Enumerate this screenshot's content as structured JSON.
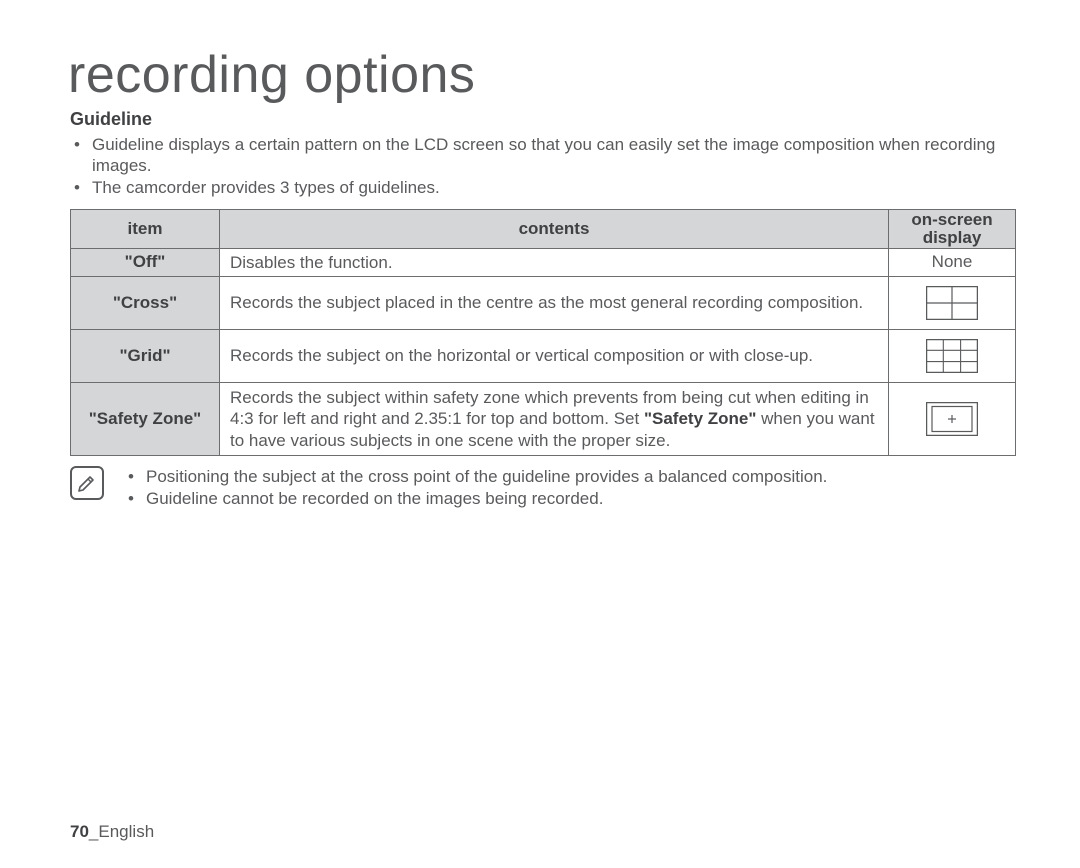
{
  "page": {
    "title": "recording options",
    "section_heading": "Guideline",
    "descriptions": [
      "Guideline displays a certain pattern on the LCD screen so that you can easily set the image composition when recording images.",
      "The camcorder provides 3 types of guidelines."
    ],
    "table": {
      "headers": {
        "item": "item",
        "contents": "contents",
        "osd": "on-screen display"
      },
      "rows": [
        {
          "item": "\"Off\"",
          "contents": "Disables the function.",
          "display": "None"
        },
        {
          "item": "\"Cross\"",
          "contents": "Records the subject placed in the centre as the most general recording composition.",
          "display": ""
        },
        {
          "item": "\"Grid\"",
          "contents": "Records the subject on the horizontal or vertical composition or with close-up.",
          "display": ""
        },
        {
          "item": "\"Safety Zone\"",
          "contents_pre": "Records the subject within safety zone which prevents from being cut when editing in 4:3 for left and right and 2.35:1 for top and bottom. Set ",
          "contents_bold": "\"Safety Zone\"",
          "contents_post": " when you want to have various subjects in one scene with the proper size.",
          "display": ""
        }
      ]
    },
    "notes": [
      "Positioning the subject at the cross point of the guideline provides a balanced composition.",
      "Guideline cannot be recorded on the images being recorded."
    ],
    "footer": {
      "page_number": "70",
      "sep": "_",
      "lang": "English"
    }
  }
}
